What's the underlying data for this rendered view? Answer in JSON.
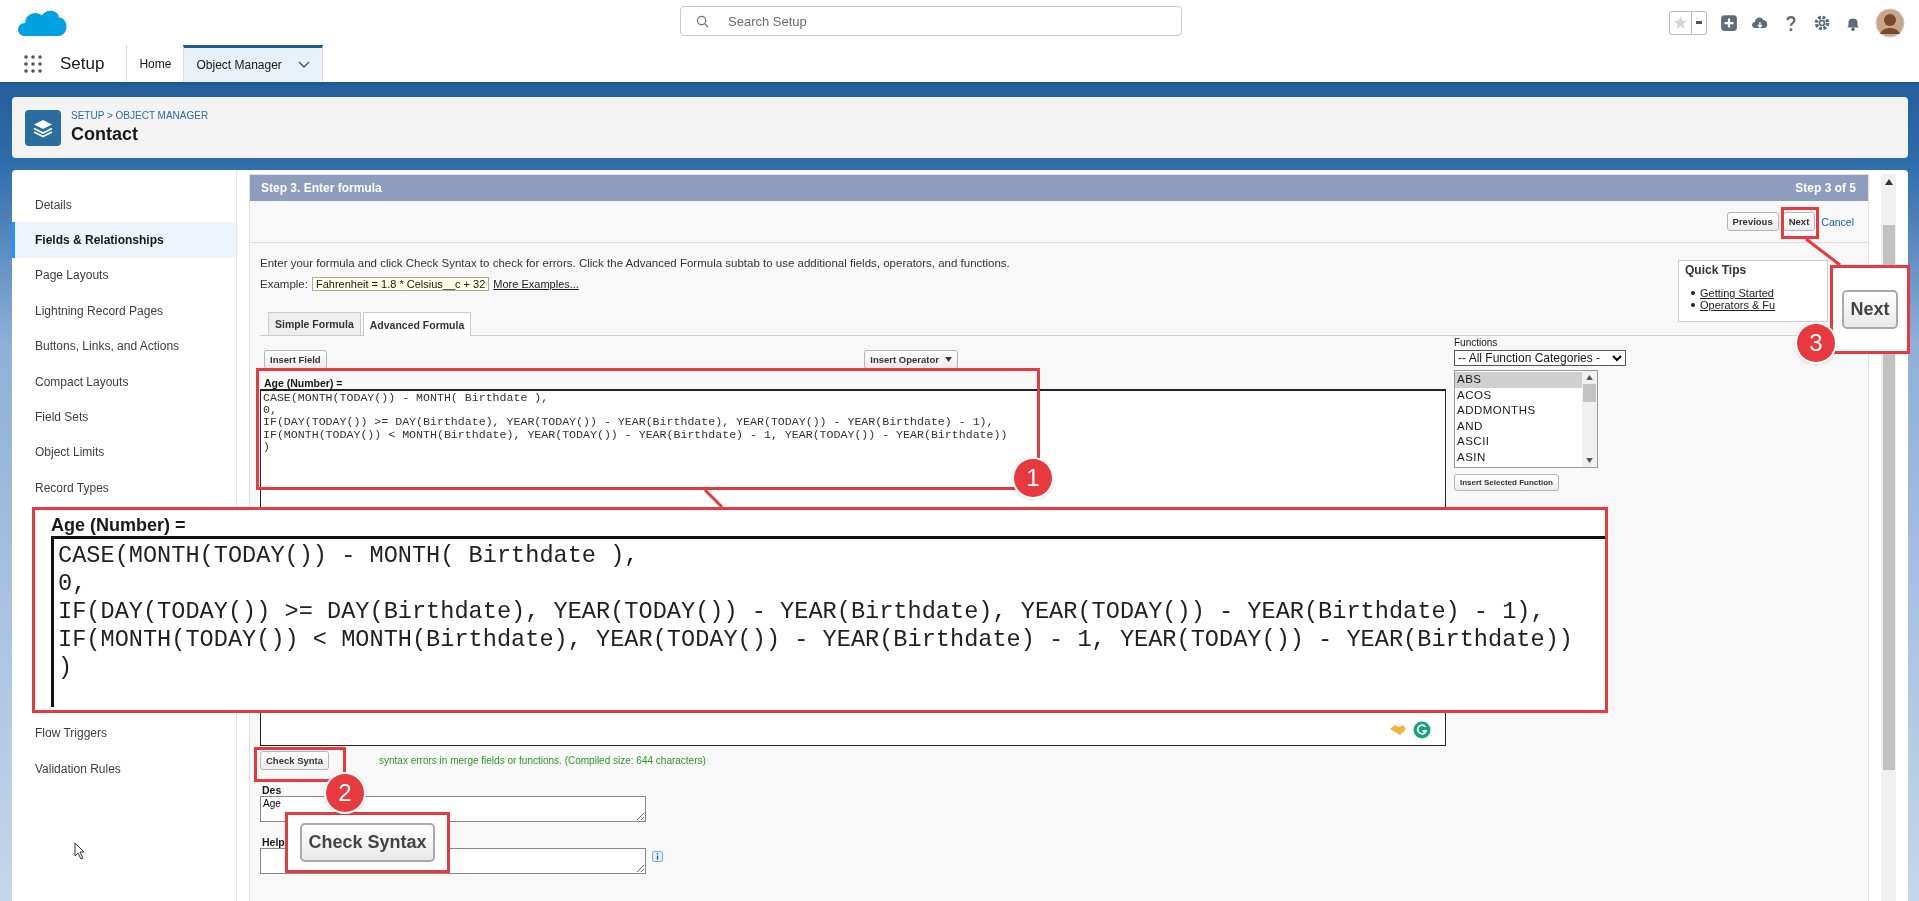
{
  "header": {
    "search_placeholder": "Search Setup"
  },
  "nav": {
    "app_name": "Setup",
    "tabs": [
      {
        "label": "Home",
        "selected": false
      },
      {
        "label": "Object Manager",
        "selected": true
      }
    ]
  },
  "page_header": {
    "breadcrumb": "SETUP > OBJECT MANAGER",
    "title": "Contact"
  },
  "sidebar": {
    "items": [
      {
        "label": "Details",
        "selected": false
      },
      {
        "label": "Fields & Relationships",
        "selected": true
      },
      {
        "label": "Page Layouts",
        "selected": false
      },
      {
        "label": "Lightning Record Pages",
        "selected": false
      },
      {
        "label": "Buttons, Links, and Actions",
        "selected": false
      },
      {
        "label": "Compact Layouts",
        "selected": false
      },
      {
        "label": "Field Sets",
        "selected": false
      },
      {
        "label": "Object Limits",
        "selected": false
      },
      {
        "label": "Record Types",
        "selected": false
      },
      {
        "label": "Flow Triggers",
        "selected": false
      },
      {
        "label": "Validation Rules",
        "selected": false
      }
    ]
  },
  "step": {
    "title": "Step 3. Enter formula",
    "counter": "Step 3 of 5",
    "buttons": [
      "Previous",
      "Next"
    ],
    "cancel": "Cancel"
  },
  "intro": "Enter your formula and click Check Syntax to check for errors. Click the Advanced Formula subtab to use additional fields, operators, and functions.",
  "example": {
    "label": "Example:",
    "value": "Fahrenheit = 1.8 * Celsius__c + 32",
    "link": "More Examples..."
  },
  "formula_tabs": [
    {
      "label": "Simple Formula",
      "selected": false
    },
    {
      "label": "Advanced Formula",
      "selected": true
    }
  ],
  "insert_field": "Insert Field",
  "insert_operator": "Insert Operator",
  "formula": {
    "label": "Age (Number) =",
    "lines": [
      "CASE(MONTH(TODAY()) - MONTH( Birthdate ),",
      "0,",
      "IF(DAY(TODAY()) >= DAY(Birthdate), YEAR(TODAY()) - YEAR(Birthdate), YEAR(TODAY()) - YEAR(Birthdate) - 1),",
      "IF(MONTH(TODAY()) < MONTH(Birthdate), YEAR(TODAY()) - YEAR(Birthdate) - 1, YEAR(TODAY()) - YEAR(Birthdate))",
      ")"
    ]
  },
  "functions": {
    "label": "Functions",
    "category": "-- All Function Categories -",
    "items": [
      {
        "name": "ABS",
        "selected": true
      },
      {
        "name": "ACOS",
        "selected": false
      },
      {
        "name": "ADDMONTHS",
        "selected": false
      },
      {
        "name": "AND",
        "selected": false
      },
      {
        "name": "ASCII",
        "selected": false
      },
      {
        "name": "ASIN",
        "selected": false
      }
    ],
    "insert_button": "Insert Selected Function"
  },
  "quick_tips": {
    "title": "Quick Tips",
    "links": [
      "Getting Started",
      "Operators & Fu"
    ]
  },
  "check_syntax": {
    "button": "Check Synta",
    "message": "syntax errors in merge fields or functions. (Compiled size: 644 characters)"
  },
  "description": {
    "label": "Des",
    "value": "Age"
  },
  "help": {
    "label": "Help"
  },
  "callouts": [
    {
      "number": "1",
      "kind": "code",
      "label": "Age (Number) =",
      "lines": [
        "CASE(MONTH(TODAY()) - MONTH( Birthdate ),",
        "0,",
        "IF(DAY(TODAY()) >= DAY(Birthdate), YEAR(TODAY()) - YEAR(Birthdate), YEAR(TODAY()) - YEAR(Birthdate) - 1),",
        "IF(MONTH(TODAY()) < MONTH(Birthdate), YEAR(TODAY()) - YEAR(Birthdate) - 1, YEAR(TODAY()) - YEAR(Birthdate))",
        ")"
      ]
    },
    {
      "number": "2",
      "kind": "button",
      "text": "Check Syntax"
    },
    {
      "number": "3",
      "kind": "button",
      "text": "Next"
    }
  ]
}
